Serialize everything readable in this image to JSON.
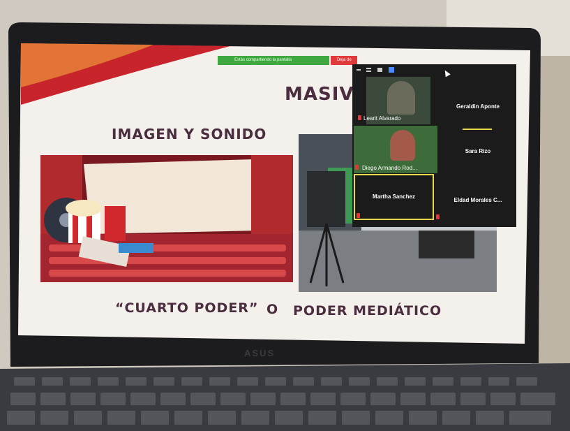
{
  "slide": {
    "title": "MASIVOS",
    "left_heading": "IMAGEN Y SONIDO",
    "bottom_left": "“CUARTO PODER”",
    "bottom_mid": "O",
    "bottom_right": "PODER MEDIÁTICO"
  },
  "zoom": {
    "share_bar_text": "Estás compartiendo la pantalla",
    "stop_label": "Deja de",
    "participants": [
      {
        "name": "Learit Alvarado",
        "video": true
      },
      {
        "name": "Geraldin Aponte",
        "video": false
      },
      {
        "name": "Diego Armando Rod...",
        "video": true
      },
      {
        "name": "Sara Rizo",
        "video": false
      },
      {
        "name": "Martha Sanchez",
        "video": false,
        "active": true
      },
      {
        "name": "Eldad Morales C...",
        "video": false
      }
    ]
  },
  "laptop": {
    "brand": "ASUS"
  },
  "colors": {
    "accent_red": "#c8242c",
    "zoom_active_border": "#e8d84a",
    "share_green": "#3fa83f"
  }
}
